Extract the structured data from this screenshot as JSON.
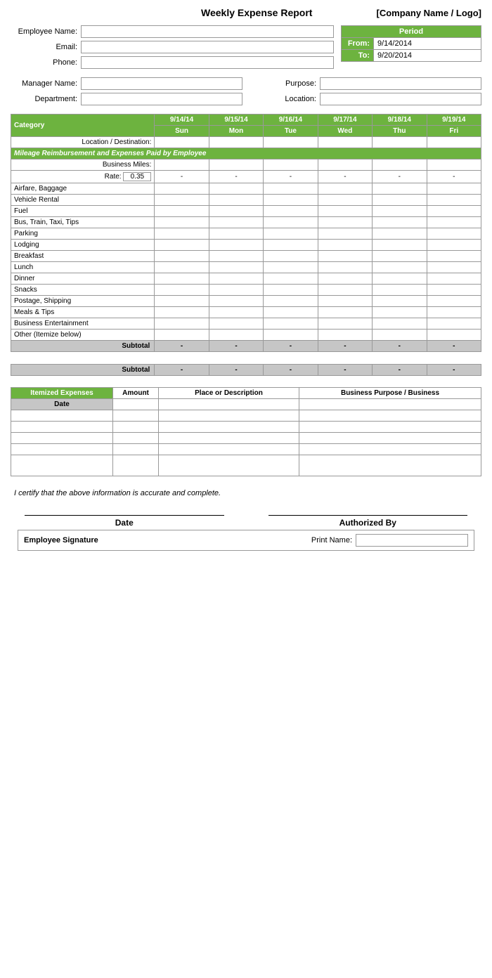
{
  "header": {
    "title": "Weekly Expense Report",
    "company": "[Company Name / Logo]"
  },
  "employee": {
    "name_label": "Employee Name:",
    "email_label": "Email:",
    "phone_label": "Phone:",
    "manager_label": "Manager Name:",
    "department_label": "Department:",
    "purpose_label": "Purpose:",
    "location_label": "Location:"
  },
  "period": {
    "header": "Period",
    "from_label": "From:",
    "from_value": "9/14/2014",
    "to_label": "To:",
    "to_value": "9/20/2014"
  },
  "table": {
    "category_header": "Category",
    "location_label": "Location / Destination:",
    "mileage_header": "Mileage Reimbursement and Expenses Paid by Employee",
    "business_miles_label": "Business Miles:",
    "rate_label": "Rate:",
    "rate_value": "0.35",
    "days": [
      {
        "date": "9/14/14",
        "name": "Sun"
      },
      {
        "date": "9/15/14",
        "name": "Mon"
      },
      {
        "date": "9/16/14",
        "name": "Tue"
      },
      {
        "date": "9/17/14",
        "name": "Wed"
      },
      {
        "date": "9/18/14",
        "name": "Thu"
      },
      {
        "date": "9/19/14",
        "name": "Fri"
      }
    ],
    "categories": [
      "Airfare, Baggage",
      "Vehicle Rental",
      "Fuel",
      "Bus, Train, Taxi, Tips",
      "Parking",
      "Lodging",
      "Breakfast",
      "Lunch",
      "Dinner",
      "Snacks",
      "Postage, Shipping",
      "Meals & Tips",
      "Business Entertainment",
      "Other (Itemize below)"
    ],
    "subtotal_label": "Subtotal",
    "dash": "-"
  },
  "itemized": {
    "header": "Itemized Expenses",
    "amount_col": "Amount",
    "place_col": "Place or Description",
    "purpose_col": "Business Purpose / Business",
    "date_row_label": "Date",
    "rows": 6
  },
  "certification": {
    "text": "I certify that the above information is accurate and complete."
  },
  "signature": {
    "date_label": "Date",
    "authorized_label": "Authorized By",
    "employee_sig_label": "Employee Signature",
    "print_name_label": "Print Name:"
  }
}
